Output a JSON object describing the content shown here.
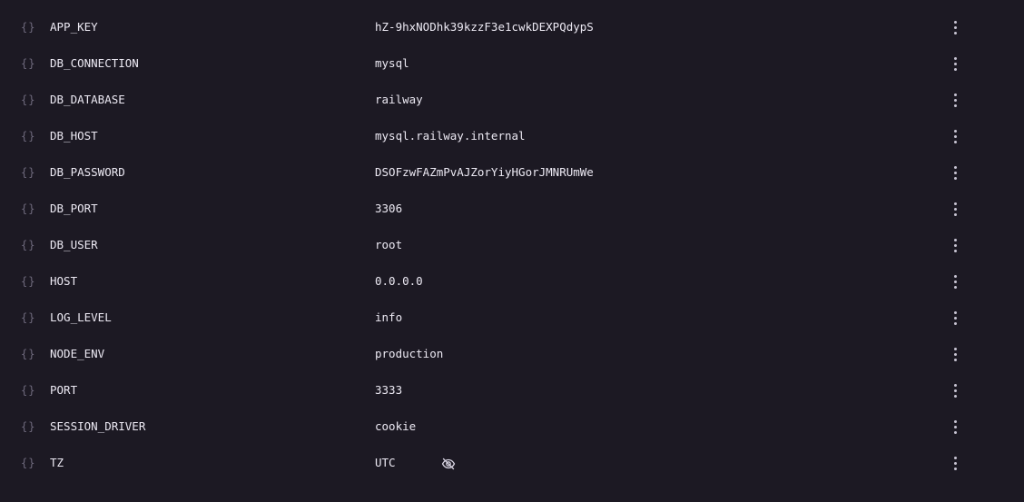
{
  "variables": [
    {
      "key": "APP_KEY",
      "value": "hZ-9hxNODhk39kzzF3e1cwkDEXPQdypS",
      "icon": "{}"
    },
    {
      "key": "DB_CONNECTION",
      "value": "mysql",
      "icon": "{}"
    },
    {
      "key": "DB_DATABASE",
      "value": "railway",
      "icon": "{}"
    },
    {
      "key": "DB_HOST",
      "value": "mysql.railway.internal",
      "icon": "{}"
    },
    {
      "key": "DB_PASSWORD",
      "value": "DSOFzwFAZmPvAJZorYiyHGorJMNRUmWe",
      "icon": "{}"
    },
    {
      "key": "DB_PORT",
      "value": "3306",
      "icon": "{}"
    },
    {
      "key": "DB_USER",
      "value": "root",
      "icon": "{}"
    },
    {
      "key": "HOST",
      "value": "0.0.0.0",
      "icon": "{}"
    },
    {
      "key": "LOG_LEVEL",
      "value": "info",
      "icon": "{}"
    },
    {
      "key": "NODE_ENV",
      "value": "production",
      "icon": "{}"
    },
    {
      "key": "PORT",
      "value": "3333",
      "icon": "{}"
    },
    {
      "key": "SESSION_DRIVER",
      "value": "cookie",
      "icon": "{}"
    },
    {
      "key": "TZ",
      "value": "UTC",
      "icon": "{}",
      "hidden_indicator": "eye-off-icon"
    }
  ],
  "colors": {
    "background": "#1c1923",
    "text": "#ece9f3",
    "muted": "#6f6a7d"
  }
}
